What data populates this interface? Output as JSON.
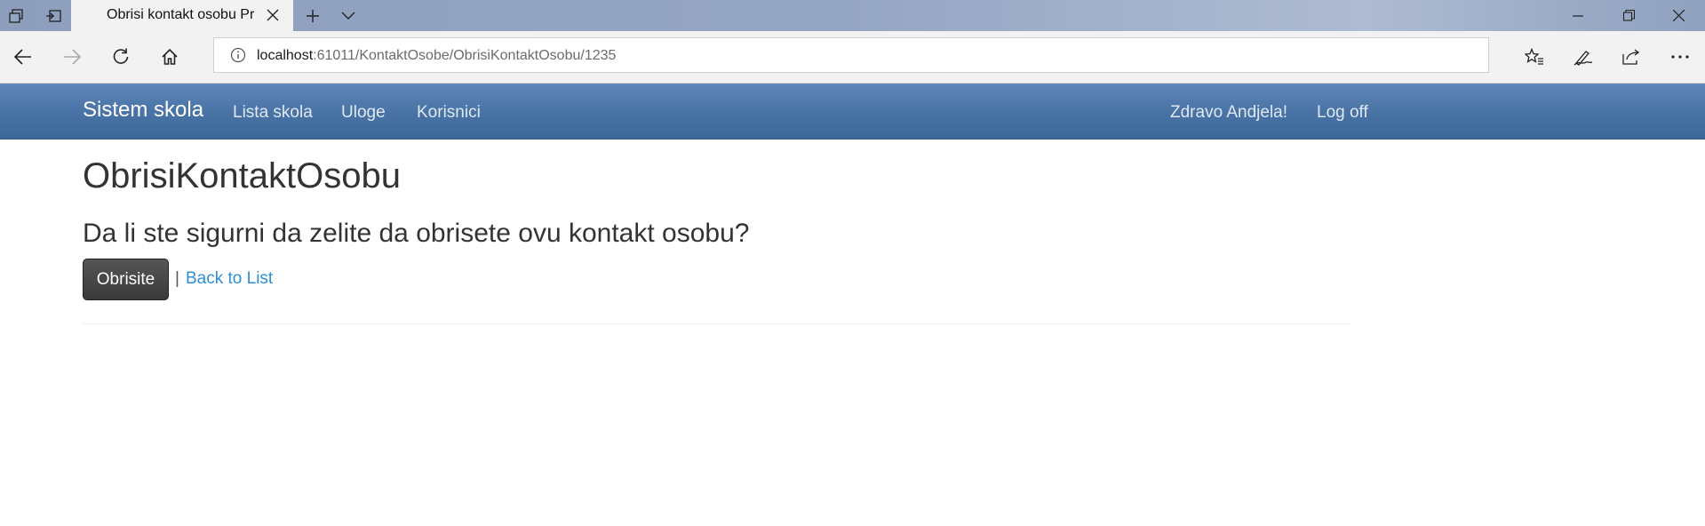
{
  "browser": {
    "tab_title": "Obrisi kontakt osobu Pr",
    "url_host": "localhost",
    "url_rest": ":61011/KontaktOsobe/ObrisiKontaktOsobu/1235",
    "icons": [
      "tab-actions-icon",
      "set-aside-tabs-icon",
      "close-icon",
      "new-tab-icon",
      "chevron-down-icon",
      "minimize-icon",
      "restore-icon",
      "close-window-icon",
      "back-icon",
      "forward-icon",
      "refresh-icon",
      "home-icon",
      "info-icon",
      "favorites-icon",
      "pen-icon",
      "share-icon",
      "more-icon"
    ]
  },
  "site": {
    "brand": "Sistem skola",
    "nav": {
      "lista_skola": "Lista skola",
      "uloge": "Uloge",
      "korisnici": "Korisnici"
    },
    "greeting": "Zdravo Andjela!",
    "logoff": "Log off"
  },
  "page": {
    "title": "ObrisiKontaktOsobu",
    "question": "Da li ste sigurni da zelite da obrisete ovu kontakt osobu?",
    "delete_label": "Obrisite",
    "separator": "|",
    "back_label": "Back to List"
  },
  "colors": {
    "navbar": "#4a74a6",
    "link": "#2b8fd6",
    "button": "#444444"
  }
}
